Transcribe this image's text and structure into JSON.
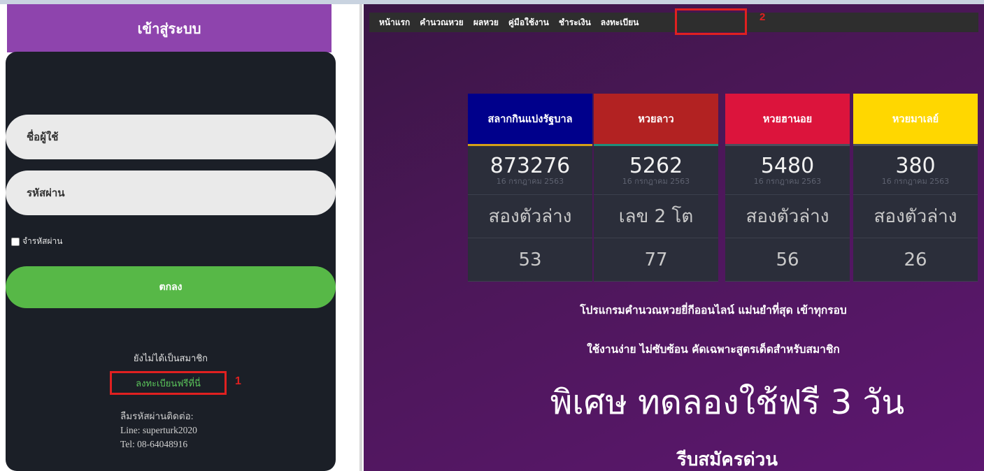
{
  "login": {
    "title": "เข้าสู่ระบบ",
    "username_placeholder": "ชื่อผู้ใช้",
    "password_placeholder": "รหัสผ่าน",
    "remember_label": "จำรหัสผ่าน",
    "submit_label": "ตกลง",
    "not_member_text": "ยังไม่ได้เป็นสมาชิก",
    "register_link": "ลงทะเบียนฟรีที่นี่",
    "forgot_title": "ลืมรหัสผ่านติดต่อ:",
    "forgot_line": "Line: superturk2020",
    "forgot_tel": "Tel: 08-64048916",
    "annotation": "1"
  },
  "nav": {
    "items": [
      "หน้าแรก",
      "คำนวณหวย",
      "ผลหวย",
      "คู่มือใช้งาน",
      "ชำระเงิน",
      "ลงทะเบียน"
    ],
    "annotation": "2"
  },
  "lottery": [
    {
      "name": "สลากกินแบ่งรัฐบาล",
      "header_color": "#00008b",
      "stripe_color": "#d4a017",
      "number": "873276",
      "date": "16 กรกฎาคม 2563",
      "type": "สองตัวล่าง",
      "result": "53"
    },
    {
      "name": "หวยลาว",
      "header_color": "#b22222",
      "stripe_color": "#1f8f7a",
      "number": "5262",
      "date": "16 กรกฎาคม 2563",
      "type": "เลข 2 โต",
      "result": "77"
    },
    {
      "name": "หวยฮานอย",
      "header_color": "#dc143c",
      "stripe_color": "#4b4f5c",
      "number": "5480",
      "date": "16 กรกฎาคม 2563",
      "type": "สองตัวล่าง",
      "result": "56"
    },
    {
      "name": "หวยมาเลย์",
      "header_color": "#ffd700",
      "stripe_color": "#4b4f5c",
      "number": "380",
      "date": "16 กรกฎาคม 2563",
      "type": "สองตัวล่าง",
      "result": "26"
    }
  ],
  "promo": {
    "line1": "โปรแกรมคำนวณหวยยี่กีออนไลน์ แม่นยำที่สุด เข้าทุกรอบ",
    "line2": "ใช้งานง่าย ไม่ซับซ้อน คัดเฉพาะสูตรเด็ดสำหรับสมาชิก",
    "headline": "พิเศษ ทดลองใช้ฟรี 3 วัน",
    "cta": "รีบสมัครด่วน"
  }
}
